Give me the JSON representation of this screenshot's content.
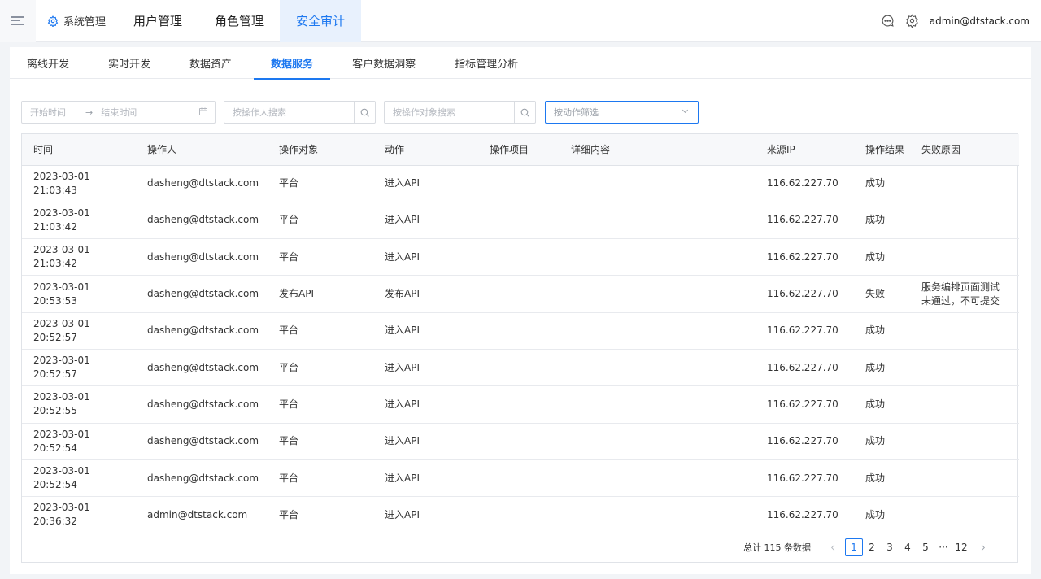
{
  "header": {
    "system_label": "系统管理",
    "nav": [
      "用户管理",
      "角色管理",
      "安全审计"
    ],
    "active_nav": 2,
    "user": "admin@dtstack.com"
  },
  "subtabs": [
    "离线开发",
    "实时开发",
    "数据资产",
    "数据服务",
    "客户数据洞察",
    "指标管理分析"
  ],
  "active_subtab": 3,
  "filters": {
    "start_placeholder": "开始时间",
    "end_placeholder": "结束时间",
    "operator_placeholder": "按操作人搜索",
    "object_placeholder": "按操作对象搜索",
    "action_placeholder": "按动作筛选"
  },
  "table": {
    "columns": [
      "时间",
      "操作人",
      "操作对象",
      "动作",
      "操作项目",
      "详细内容",
      "来源IP",
      "操作结果",
      "失败原因"
    ],
    "rows": [
      [
        "2023-03-01 21:03:43",
        "dasheng@dtstack.com",
        "平台",
        "进入API",
        "",
        "",
        "116.62.227.70",
        "成功",
        ""
      ],
      [
        "2023-03-01 21:03:42",
        "dasheng@dtstack.com",
        "平台",
        "进入API",
        "",
        "",
        "116.62.227.70",
        "成功",
        ""
      ],
      [
        "2023-03-01 21:03:42",
        "dasheng@dtstack.com",
        "平台",
        "进入API",
        "",
        "",
        "116.62.227.70",
        "成功",
        ""
      ],
      [
        "2023-03-01 20:53:53",
        "dasheng@dtstack.com",
        "发布API",
        "发布API",
        "",
        "",
        "116.62.227.70",
        "失败",
        "服务编排页面测试未通过，不可提交"
      ],
      [
        "2023-03-01 20:52:57",
        "dasheng@dtstack.com",
        "平台",
        "进入API",
        "",
        "",
        "116.62.227.70",
        "成功",
        ""
      ],
      [
        "2023-03-01 20:52:57",
        "dasheng@dtstack.com",
        "平台",
        "进入API",
        "",
        "",
        "116.62.227.70",
        "成功",
        ""
      ],
      [
        "2023-03-01 20:52:55",
        "dasheng@dtstack.com",
        "平台",
        "进入API",
        "",
        "",
        "116.62.227.70",
        "成功",
        ""
      ],
      [
        "2023-03-01 20:52:54",
        "dasheng@dtstack.com",
        "平台",
        "进入API",
        "",
        "",
        "116.62.227.70",
        "成功",
        ""
      ],
      [
        "2023-03-01 20:52:54",
        "dasheng@dtstack.com",
        "平台",
        "进入API",
        "",
        "",
        "116.62.227.70",
        "成功",
        ""
      ],
      [
        "2023-03-01 20:36:32",
        "admin@dtstack.com",
        "平台",
        "进入API",
        "",
        "",
        "116.62.227.70",
        "成功",
        ""
      ]
    ]
  },
  "pagination": {
    "total_text": "总计 115 条数据",
    "pages": [
      "1",
      "2",
      "3",
      "4",
      "5",
      "···",
      "12"
    ],
    "current": "1"
  }
}
